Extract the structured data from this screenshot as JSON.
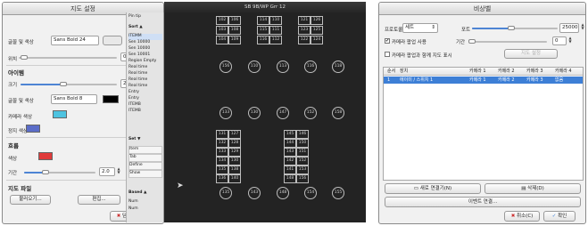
{
  "left_panel": {
    "title": "지도 설정",
    "font_color_label": "글꼴 및 색상",
    "font_value": "Sans Bold  24",
    "position_label": "위치",
    "position_value": "0.0",
    "icon_section": "아이템",
    "size_label": "크기",
    "size_value": "24",
    "icon_font_label": "글꼴 및 색상",
    "icon_font_value": "Sans Bold  8",
    "camera_color_label": "카메라 색상",
    "camera_color": "#4ec3e0",
    "group_color_label": "정지 색상",
    "group_color": "#5b6dc8",
    "flow_section": "흐름",
    "flow_color_label": "색상",
    "flow_color": "#e03a3a",
    "interval_label": "기간",
    "interval_value": "2.0",
    "map_file_section": "지도 파일",
    "load_button": "불러오기...",
    "edit_button": "편집...",
    "close_button": "닫기(C)",
    "position_slider_level": 0.05,
    "size_slider_level": 0.45,
    "interval_slider_level": 0.3
  },
  "middle_panel": {
    "top_label": "Pin tip",
    "section1": "Sort ▲",
    "items": [
      "ITEMM",
      "Sen 10000",
      "Sen 10000",
      "Sen 10001",
      "Region Empty",
      "Real time",
      "Real time",
      "Real time",
      "Real time",
      "Entry",
      "Entry",
      "ITEMB",
      "ITEMB"
    ],
    "section2": "Set ▼",
    "items2": [
      "Item",
      "Tab",
      "Define",
      "Show"
    ],
    "section3": "Based ▲",
    "items3": [
      "Num",
      "Num"
    ]
  },
  "canvas": {
    "title": "SB 9B/WP Grr 12",
    "top_stalls": [
      "102",
      "106",
      "114",
      "110",
      "121",
      "126",
      "103",
      "108",
      "115",
      "111",
      "123",
      "125",
      "104",
      "109",
      "116",
      "112",
      "122",
      "124"
    ],
    "row1_circles": [
      "156",
      "110",
      "113",
      "116",
      "118"
    ],
    "row2_circles": [
      "133",
      "130",
      "147",
      "152",
      "158"
    ],
    "mid_stalls": [
      "131",
      "127",
      "145",
      "146",
      "132",
      "128",
      "144",
      "150",
      "133",
      "129",
      "143",
      "151",
      "134",
      "130",
      "142",
      "152",
      "135",
      "138",
      "141",
      "153",
      "136",
      "140",
      "148",
      "156"
    ],
    "row3_circles": [
      "135",
      "143",
      "148",
      "154",
      "155"
    ]
  },
  "right_panel": {
    "title": "비상벨",
    "protocol_label": "프로토콜",
    "protocol_value": "세트",
    "port_label": "포트",
    "port_value": "25000",
    "camera_popup_label": "카메라 팝업 사용",
    "camera_popup_checked": true,
    "period_label": "기간",
    "period_value": "0",
    "show_map_label": "카메라 팝업과 함께 지도 표시",
    "show_map_checked": false,
    "gray_button": "지도 설정",
    "columns": [
      "순서",
      "장치",
      "카메라 1",
      "카메라 2",
      "카메라 3",
      "카메라 4"
    ],
    "rows": [
      [
        "1",
        "에이미 / 스위치 1",
        "카메라 1",
        "카메라 2",
        "카메라 3",
        "없음"
      ]
    ],
    "new_connection_button": "새로 연결기(N)",
    "delete_button": "삭제(D)",
    "event_button": "이벤트 연결...",
    "cancel_button": "취소(C)",
    "ok_button": "확인",
    "port_slider_level": 0.45,
    "accent": "#3d7fd6"
  }
}
